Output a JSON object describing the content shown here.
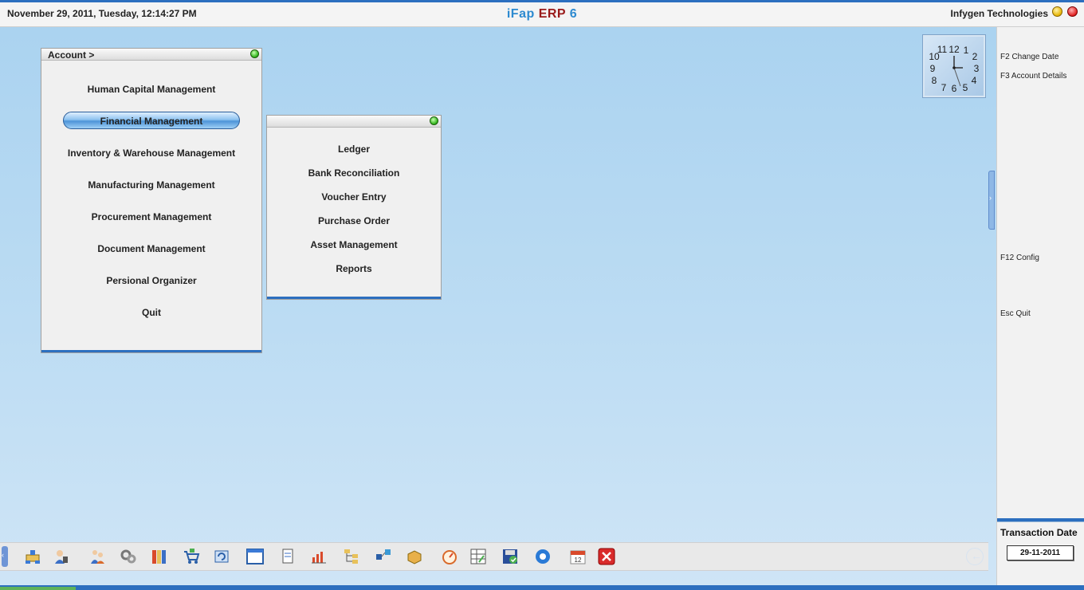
{
  "header": {
    "datetime": "November  29, 2011, Tuesday, 12:14:27 PM",
    "title_part1": "iFap ",
    "title_part2": "ERP ",
    "title_part3": "6",
    "company": "Infygen Technologies"
  },
  "main_menu": {
    "title": "Account >",
    "items": [
      {
        "label": "Human Capital Management"
      },
      {
        "label": "Financial Management",
        "active": true
      },
      {
        "label": "Inventory & Warehouse Management"
      },
      {
        "label": "Manufacturing Management"
      },
      {
        "label": "Procurement Management"
      },
      {
        "label": "Document Management"
      },
      {
        "label": "Persional Organizer"
      },
      {
        "label": "Quit"
      }
    ]
  },
  "sub_menu": {
    "items": [
      {
        "label": "Ledger"
      },
      {
        "label": "Bank Reconciliation"
      },
      {
        "label": "Voucher Entry"
      },
      {
        "label": "Purchase Order"
      },
      {
        "label": "Asset Management"
      },
      {
        "label": "Reports"
      }
    ]
  },
  "right_panel": {
    "shortcuts": [
      {
        "label": "F2 Change Date"
      },
      {
        "label": "F3 Account Details"
      },
      {
        "label": "F12 Config"
      },
      {
        "label": "Esc Quit"
      }
    ],
    "transaction_label": "Transaction Date",
    "transaction_date": "29-11-2011"
  },
  "toolbar": {
    "icons": [
      "network-icon",
      "user-phone-icon",
      "users-icon",
      "gears-icon",
      "books-icon",
      "cart-icon",
      "refresh-icon",
      "window-icon",
      "document-icon",
      "chart-icon",
      "tree-icon",
      "flow-icon",
      "box-icon",
      "gauge-icon",
      "calculator-icon",
      "save-icon",
      "settings-icon",
      "calendar-icon",
      "close-icon"
    ],
    "calendar_day": "12"
  },
  "colors": {
    "accent_blue": "#2c6fbf",
    "title_blue": "#2d8ad0",
    "title_red": "#9a1b1b",
    "background": "#bcdcf3"
  }
}
